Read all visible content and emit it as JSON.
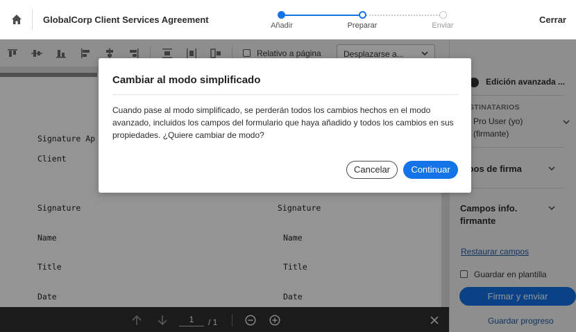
{
  "header": {
    "title": "GlobalCorp Client Services Agreement",
    "close_label": "Cerrar",
    "steps": [
      {
        "label": "Añadir",
        "state": "complete"
      },
      {
        "label": "Preparar",
        "state": "current"
      },
      {
        "label": "Enviar",
        "state": "upcoming"
      }
    ]
  },
  "toolbar": {
    "relative_label": "Relativo a página",
    "scroll_select_value": "Desplazarse a..."
  },
  "document": {
    "lines": {
      "sig_approval": "Signature Ap",
      "client": "Client",
      "signature_left": "Signature",
      "signature_right": "Signature",
      "name_left": "Name",
      "name_right": "Name",
      "title_left": "Title",
      "title_right": "Title",
      "date_left": "Date",
      "date_right": "Date"
    }
  },
  "bottom_nav": {
    "current_page": "1",
    "total_pages": "/ 1"
  },
  "right_panel": {
    "advanced_label": "Edición avanzada ...",
    "recipients_title": "STINATARIOS",
    "recipient_name": "Pro User (yo)",
    "recipient_role": "(firmante)",
    "signature_fields": "mpos de firma",
    "signer_info_fields": "Campos info. firmante",
    "restore_fields": "Restaurar campos",
    "save_template": "Guardar en plantilla",
    "sign_send": "Firmar y enviar",
    "save_progress": "Guardar progreso"
  },
  "dialog": {
    "title": "Cambiar al modo simplificado",
    "body": "Cuando pase al modo simplificado, se perderán todos los cambios hechos en el modo avanzado, incluidos los campos del formulario que haya añadido y todos los cambios en sus propiedades. ¿Quiere cambiar de modo?",
    "cancel_label": "Cancelar",
    "continue_label": "Continuar"
  },
  "colors": {
    "accent": "#1473e6",
    "link": "#1d5aa6",
    "overlay": "rgba(0,0,0,0.42)"
  }
}
